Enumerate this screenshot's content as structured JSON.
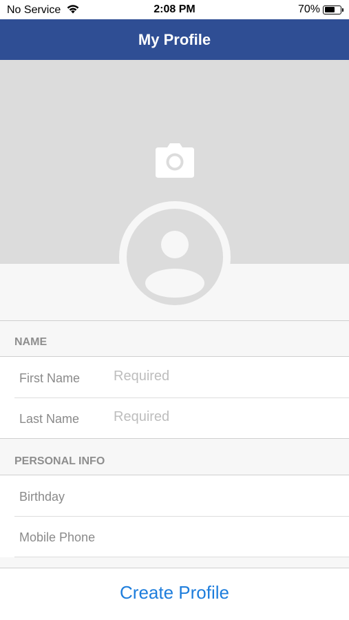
{
  "status_bar": {
    "carrier": "No Service",
    "time": "2:08 PM",
    "battery_percent": "70%",
    "battery_level": 0.7
  },
  "nav": {
    "title": "My Profile"
  },
  "icons": {
    "camera": "camera-icon",
    "avatar": "person-placeholder-icon",
    "wifi": "wifi-icon",
    "battery": "battery-icon"
  },
  "sections": {
    "name": {
      "header": "NAME",
      "first_name_label": "First Name",
      "first_name_placeholder": "Required",
      "last_name_label": "Last Name",
      "last_name_placeholder": "Required"
    },
    "personal_info": {
      "header": "PERSONAL INFO",
      "birthday_label": "Birthday",
      "mobile_phone_label": "Mobile Phone"
    }
  },
  "actions": {
    "create_profile": "Create Profile"
  },
  "colors": {
    "nav_background": "#2f4e94",
    "accent": "#1d7ddc",
    "cover_background": "#dcdcdc"
  }
}
